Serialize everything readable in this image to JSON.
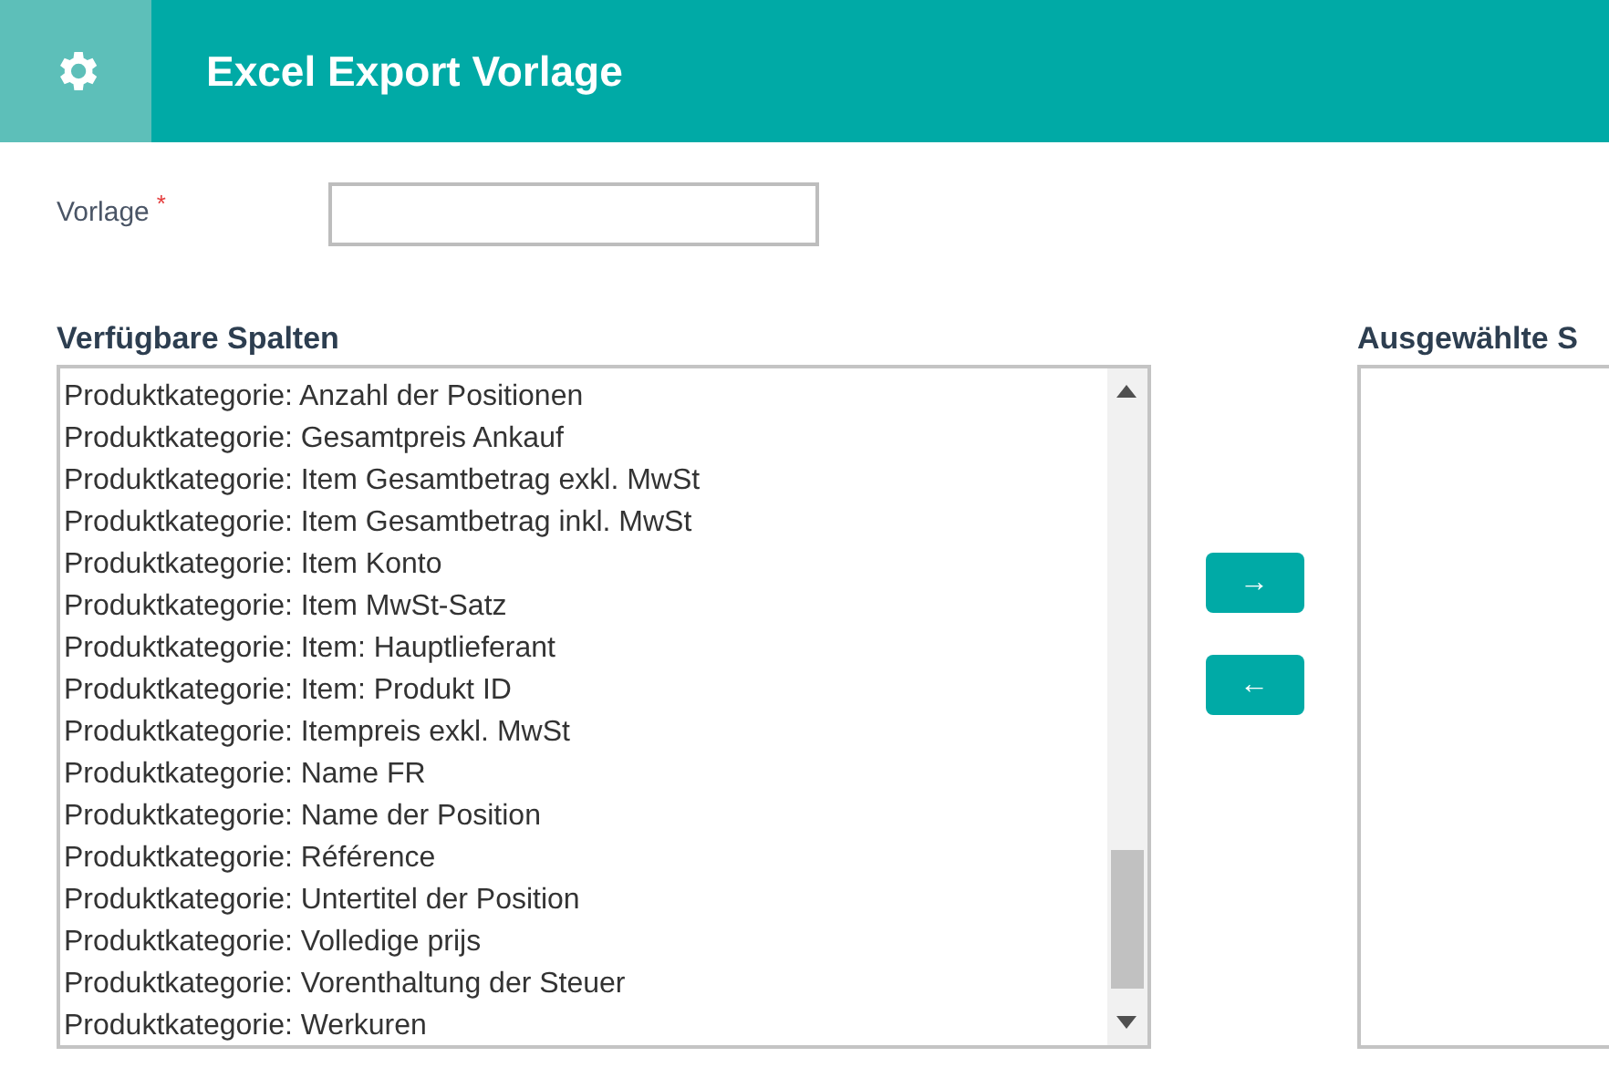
{
  "header": {
    "title": "Excel Export Vorlage"
  },
  "vorlage": {
    "label": "Vorlage",
    "required_mark": "*"
  },
  "available": {
    "heading": "Verfügbare Spalten",
    "items": [
      "Produktkategorie: Anzahl der Positionen",
      "Produktkategorie: Gesamtpreis Ankauf",
      "Produktkategorie: Item Gesamtbetrag exkl. MwSt",
      "Produktkategorie: Item Gesamtbetrag inkl. MwSt",
      "Produktkategorie: Item Konto",
      "Produktkategorie: Item MwSt-Satz",
      "Produktkategorie: Item: Hauptlieferant",
      "Produktkategorie: Item: Produkt ID",
      "Produktkategorie: Itempreis exkl. MwSt",
      "Produktkategorie: Name FR",
      "Produktkategorie: Name der Position",
      "Produktkategorie: Référence",
      "Produktkategorie: Untertitel der Position",
      "Produktkategorie: Volledige prijs",
      "Produktkategorie: Vorenthaltung der Steuer",
      "Produktkategorie: Werkuren"
    ]
  },
  "buttons": [
    {
      "label": "→"
    },
    {
      "label": "←"
    }
  ],
  "selected": {
    "heading": "Ausgewählte S"
  }
}
